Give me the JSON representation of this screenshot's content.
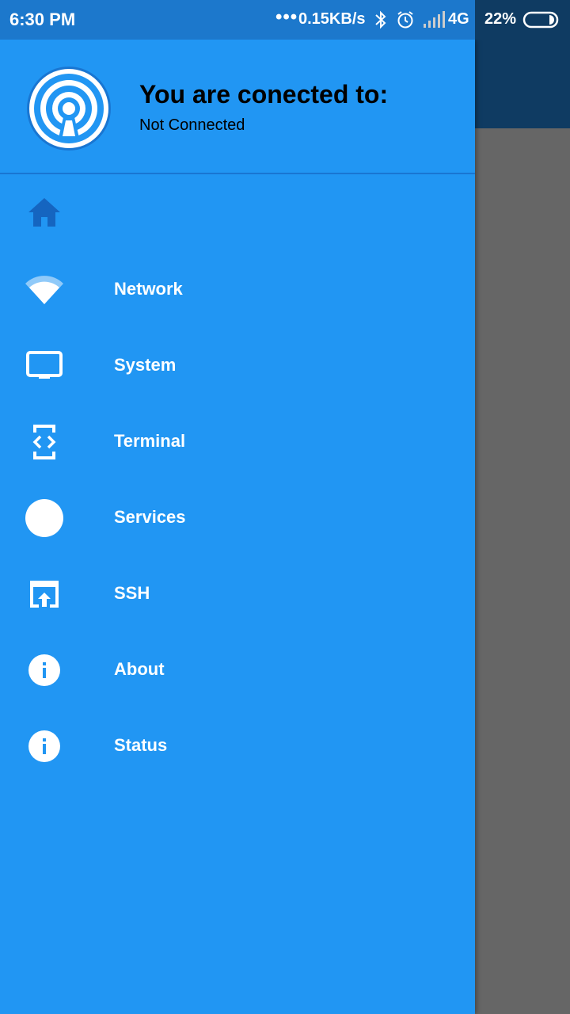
{
  "status_bar": {
    "time": "6:30 PM",
    "dots": "•••",
    "speed": "0.15KB/s",
    "network": "4G",
    "battery": "22%"
  },
  "drawer": {
    "header": {
      "title": "You are conected to:",
      "subtitle": "Not Connected"
    },
    "home_icon": "home-icon",
    "items": [
      {
        "label": "Network",
        "icon": "wifi-icon"
      },
      {
        "label": "System",
        "icon": "monitor-icon"
      },
      {
        "label": "Terminal",
        "icon": "code-icon"
      },
      {
        "label": "Services",
        "icon": "circle-icon"
      },
      {
        "label": "SSH",
        "icon": "upload-box-icon"
      },
      {
        "label": "About",
        "icon": "info-icon"
      },
      {
        "label": "Status",
        "icon": "info-icon"
      }
    ]
  },
  "colors": {
    "drawer_bg": "#2196f3",
    "status_bar": "#1c78cc",
    "app_toolbar": "#0f3b62",
    "scrim": "#666666"
  }
}
